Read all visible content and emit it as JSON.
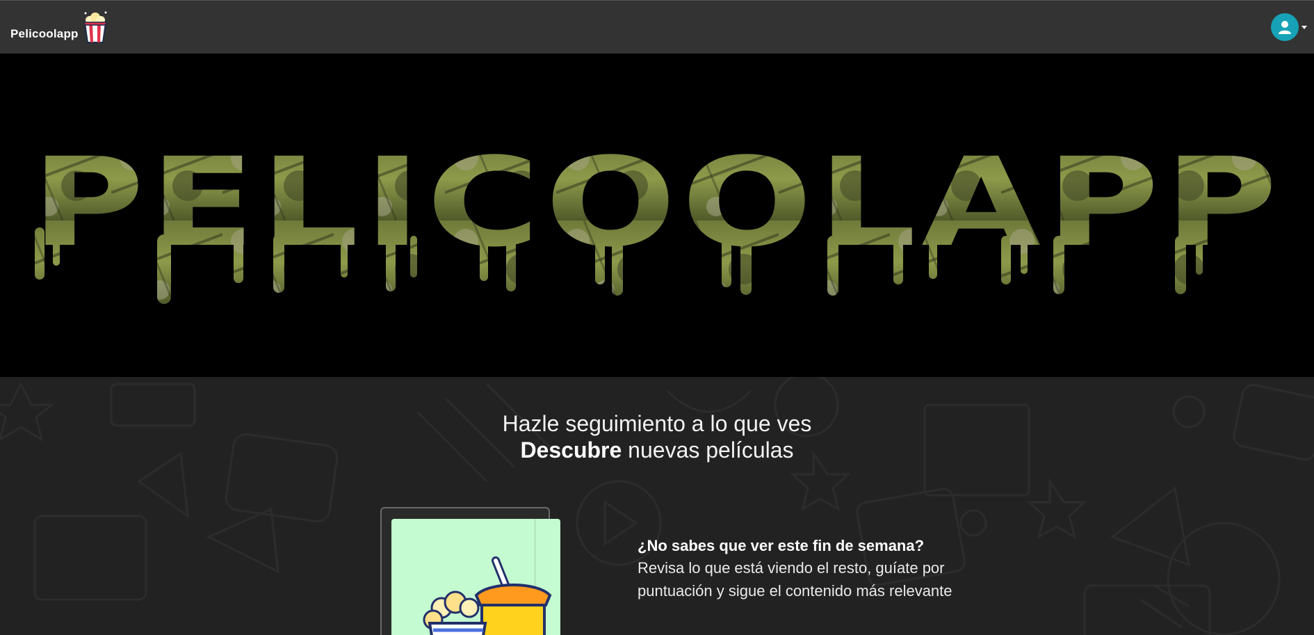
{
  "navbar": {
    "brand_name": "Pelicoolapp",
    "logo_icon": "popcorn-bucket-icon",
    "user_icon": "user-avatar-icon",
    "accent_color": "#17a2b8"
  },
  "hero": {
    "title": "PELICOOLAPP",
    "background_color": "#000000"
  },
  "intro": {
    "line1": "Hazle seguimiento a lo que ves",
    "line2_bold": "Descubre",
    "line2_rest": " nuevas películas"
  },
  "feature": {
    "illustration_icon": "popcorn-and-soda-icon",
    "title": "¿No sabes que ver este fin de semana?",
    "description": "Revisa lo que está viendo el resto, guíate por puntuación y sigue el contenido más relevante"
  }
}
